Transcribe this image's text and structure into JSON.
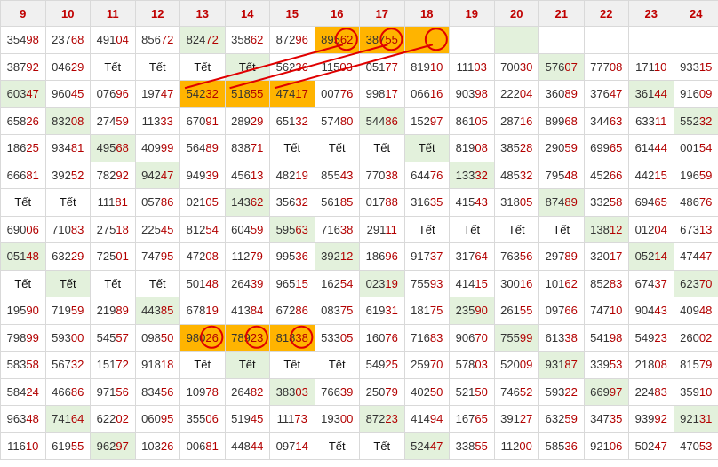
{
  "columns": [
    "9",
    "10",
    "11",
    "12",
    "13",
    "14",
    "15",
    "16",
    "17",
    "18",
    "19",
    "20",
    "21",
    "22",
    "23",
    "24"
  ],
  "rows": [
    [
      "35498",
      "23768",
      "49104",
      "85672",
      "82472",
      "35862",
      "87296",
      "89562",
      "38755",
      "",
      "",
      "",
      "",
      "",
      "",
      ""
    ],
    [
      "38792",
      "04629",
      "Tết",
      "Tết",
      "Tết",
      "Tết",
      "56236",
      "11503",
      "05177",
      "81910",
      "11103",
      "70030",
      "57607",
      "77708",
      "17110",
      "93315"
    ],
    [
      "60347",
      "96045",
      "07696",
      "19747",
      "54232",
      "51855",
      "47417",
      "00776",
      "99817",
      "06616",
      "90398",
      "22204",
      "36089",
      "37647",
      "36144",
      "91609"
    ],
    [
      "65826",
      "83208",
      "27459",
      "11333",
      "67091",
      "28929",
      "65132",
      "57480",
      "54486",
      "15297",
      "86105",
      "28716",
      "89968",
      "34463",
      "63311",
      "55232"
    ],
    [
      "18625",
      "93481",
      "49568",
      "40999",
      "56489",
      "83871",
      "Tết",
      "Tết",
      "Tết",
      "Tết",
      "81908",
      "38528",
      "29059",
      "69965",
      "61444",
      "00154"
    ],
    [
      "66681",
      "39252",
      "78292",
      "94247",
      "94939",
      "45613",
      "48219",
      "85543",
      "77038",
      "64476",
      "13332",
      "48532",
      "79548",
      "45266",
      "44215",
      "19659"
    ],
    [
      "Tết",
      "Tết",
      "11181",
      "05786",
      "02105",
      "14362",
      "35632",
      "56185",
      "01788",
      "31635",
      "41543",
      "31805",
      "87489",
      "33258",
      "69465",
      "48676"
    ],
    [
      "69006",
      "71083",
      "27518",
      "22545",
      "81254",
      "60459",
      "59563",
      "71638",
      "29111",
      "Tết",
      "Tết",
      "Tết",
      "Tết",
      "13812",
      "01204",
      "67313"
    ],
    [
      "05148",
      "63229",
      "72501",
      "74795",
      "47208",
      "11279",
      "99536",
      "39212",
      "18696",
      "91737",
      "31764",
      "76356",
      "29789",
      "32017",
      "05214",
      "47447"
    ],
    [
      "Tết",
      "Tết",
      "Tết",
      "Tết",
      "50148",
      "26439",
      "96515",
      "16254",
      "02319",
      "75593",
      "41415",
      "30016",
      "10162",
      "85283",
      "67437",
      "62370"
    ],
    [
      "19590",
      "71959",
      "21989",
      "44385",
      "67819",
      "41384",
      "67286",
      "08375",
      "61931",
      "18175",
      "23590",
      "26155",
      "09766",
      "74710",
      "90443",
      "40948"
    ],
    [
      "79899",
      "59300",
      "54557",
      "09850",
      "98026",
      "78923",
      "81838",
      "53305",
      "16076",
      "71683",
      "90670",
      "75599",
      "61338",
      "54198",
      "54923",
      "26002"
    ],
    [
      "58358",
      "56732",
      "15172",
      "91818",
      "Tết",
      "Tết",
      "Tết",
      "Tết",
      "54925",
      "25970",
      "57803",
      "52009",
      "93187",
      "33953",
      "21808",
      "81579"
    ],
    [
      "58424",
      "46686",
      "97156",
      "83456",
      "10978",
      "26482",
      "38303",
      "76639",
      "25079",
      "40250",
      "52150",
      "74652",
      "59322",
      "66997",
      "22483",
      "35910"
    ],
    [
      "96348",
      "74164",
      "62202",
      "06095",
      "35506",
      "51945",
      "11173",
      "19300",
      "87223",
      "41494",
      "16765",
      "39127",
      "63259",
      "34735",
      "93992",
      "92131"
    ],
    [
      "11610",
      "61955",
      "96297",
      "10326",
      "00681",
      "44844",
      "09714",
      "Tết",
      "Tết",
      "52447",
      "33855",
      "11200",
      "58536",
      "92106",
      "50247",
      "47053"
    ]
  ],
  "green_cells": [
    [
      0,
      4
    ],
    [
      0,
      11
    ],
    [
      1,
      5
    ],
    [
      1,
      12
    ],
    [
      2,
      0
    ],
    [
      2,
      14
    ],
    [
      3,
      1
    ],
    [
      3,
      8
    ],
    [
      3,
      15
    ],
    [
      4,
      2
    ],
    [
      4,
      9
    ],
    [
      5,
      3
    ],
    [
      5,
      10
    ],
    [
      6,
      5
    ],
    [
      6,
      12
    ],
    [
      7,
      6
    ],
    [
      7,
      13
    ],
    [
      8,
      0
    ],
    [
      8,
      7
    ],
    [
      8,
      14
    ],
    [
      9,
      1
    ],
    [
      9,
      8
    ],
    [
      9,
      15
    ],
    [
      10,
      3
    ],
    [
      10,
      10
    ],
    [
      11,
      11
    ],
    [
      12,
      5
    ],
    [
      12,
      12
    ],
    [
      13,
      6
    ],
    [
      13,
      13
    ],
    [
      14,
      1
    ],
    [
      14,
      8
    ],
    [
      14,
      15
    ],
    [
      15,
      2
    ],
    [
      15,
      9
    ]
  ],
  "orange_cells": [
    [
      0,
      7
    ],
    [
      0,
      8
    ],
    [
      0,
      9
    ],
    [
      2,
      4
    ],
    [
      2,
      5
    ],
    [
      2,
      6
    ],
    [
      11,
      4
    ],
    [
      11,
      5
    ],
    [
      11,
      6
    ]
  ],
  "colors": {
    "header_text": "#c00000",
    "highlight_green": "#e3f1dc",
    "highlight_orange": "#ffb400",
    "annotation_red": "#e00000"
  },
  "annotations": {
    "circles": [
      [
        0,
        7
      ],
      [
        0,
        8
      ],
      [
        0,
        9
      ],
      [
        11,
        4
      ],
      [
        11,
        5
      ],
      [
        11,
        6
      ]
    ],
    "lines": [
      [
        [
          2,
          4
        ],
        [
          0,
          7
        ]
      ],
      [
        [
          2,
          5
        ],
        [
          0,
          8
        ]
      ],
      [
        [
          2,
          6
        ],
        [
          0,
          9
        ]
      ]
    ]
  }
}
